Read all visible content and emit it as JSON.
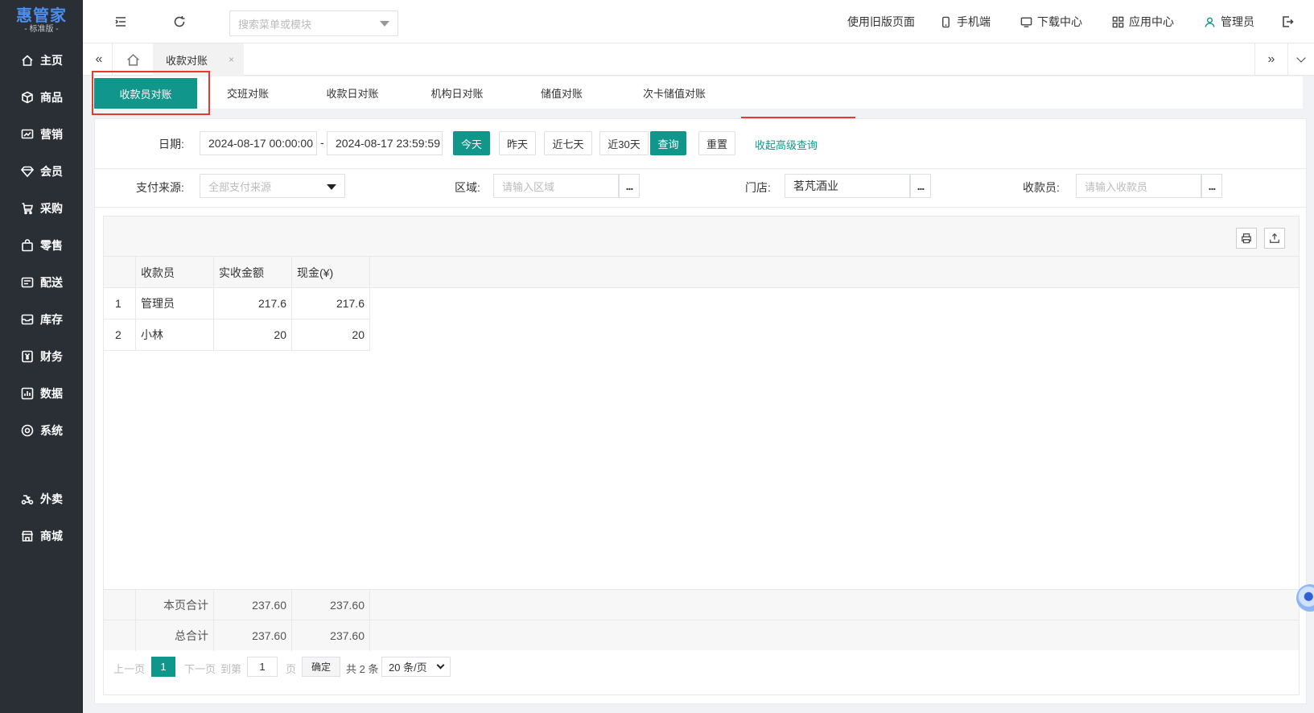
{
  "app": {
    "brand": "惠管家",
    "edition": "- 标准版 -"
  },
  "sidebar": {
    "items": [
      {
        "label": "主页",
        "icon": "home-icon"
      },
      {
        "label": "商品",
        "icon": "box-icon"
      },
      {
        "label": "营销",
        "icon": "chart-icon"
      },
      {
        "label": "会员",
        "icon": "diamond-icon"
      },
      {
        "label": "采购",
        "icon": "cart-icon"
      },
      {
        "label": "零售",
        "icon": "bag-icon"
      },
      {
        "label": "配送",
        "icon": "truck-icon"
      },
      {
        "label": "库存",
        "icon": "inbox-icon"
      },
      {
        "label": "财务",
        "icon": "yen-icon"
      },
      {
        "label": "数据",
        "icon": "data-icon"
      },
      {
        "label": "系统",
        "icon": "settings-icon"
      },
      {
        "label": "外卖",
        "icon": "delivery-icon"
      },
      {
        "label": "商城",
        "icon": "store-icon"
      }
    ]
  },
  "topbar": {
    "search_placeholder": "搜索菜单或模块",
    "old_page": "使用旧版页面",
    "mobile": "手机端",
    "download": "下载中心",
    "apps": "应用中心",
    "user": "管理员"
  },
  "tabs": {
    "current": "收款对账",
    "close": "×"
  },
  "subtabs": [
    "收款员对账",
    "交班对账",
    "收款日对账",
    "机构日对账",
    "储值对账",
    "次卡储值对账"
  ],
  "filters": {
    "date_label": "日期:",
    "date_start": "2024-08-17 00:00:00",
    "date_sep": "-",
    "date_end": "2024-08-17 23:59:59",
    "btn_today": "今天",
    "btn_yesterday": "昨天",
    "btn_7days": "近七天",
    "btn_30days": "近30天",
    "btn_query": "查询",
    "btn_reset": "重置",
    "advanced_toggle": "收起高级查询",
    "pay_source_label": "支付来源:",
    "pay_source_value": "全部支付来源",
    "region_label": "区域:",
    "region_placeholder": "请输入区域",
    "store_label": "门店:",
    "store_value": "茗芃酒业",
    "cashier_label": "收款员:",
    "cashier_placeholder": "请输入收款员",
    "more": "..."
  },
  "table": {
    "columns": [
      "收款员",
      "实收金额",
      "现金(¥)"
    ],
    "rows": [
      {
        "index": "1",
        "cashier": "管理员",
        "received": "217.6",
        "cash": "217.6"
      },
      {
        "index": "2",
        "cashier": "小林",
        "received": "20",
        "cash": "20"
      }
    ],
    "page_total_label": "本页合计",
    "page_total_received": "237.60",
    "page_total_cash": "237.60",
    "grand_total_label": "总合计",
    "grand_total_received": "237.60",
    "grand_total_cash": "237.60"
  },
  "pager": {
    "prev": "上一页",
    "current": "1",
    "next": "下一页",
    "goto": "到第",
    "goto_value": "1",
    "page_unit": "页",
    "confirm": "确定",
    "total": "共 2 条",
    "page_size": "20 条/页"
  }
}
